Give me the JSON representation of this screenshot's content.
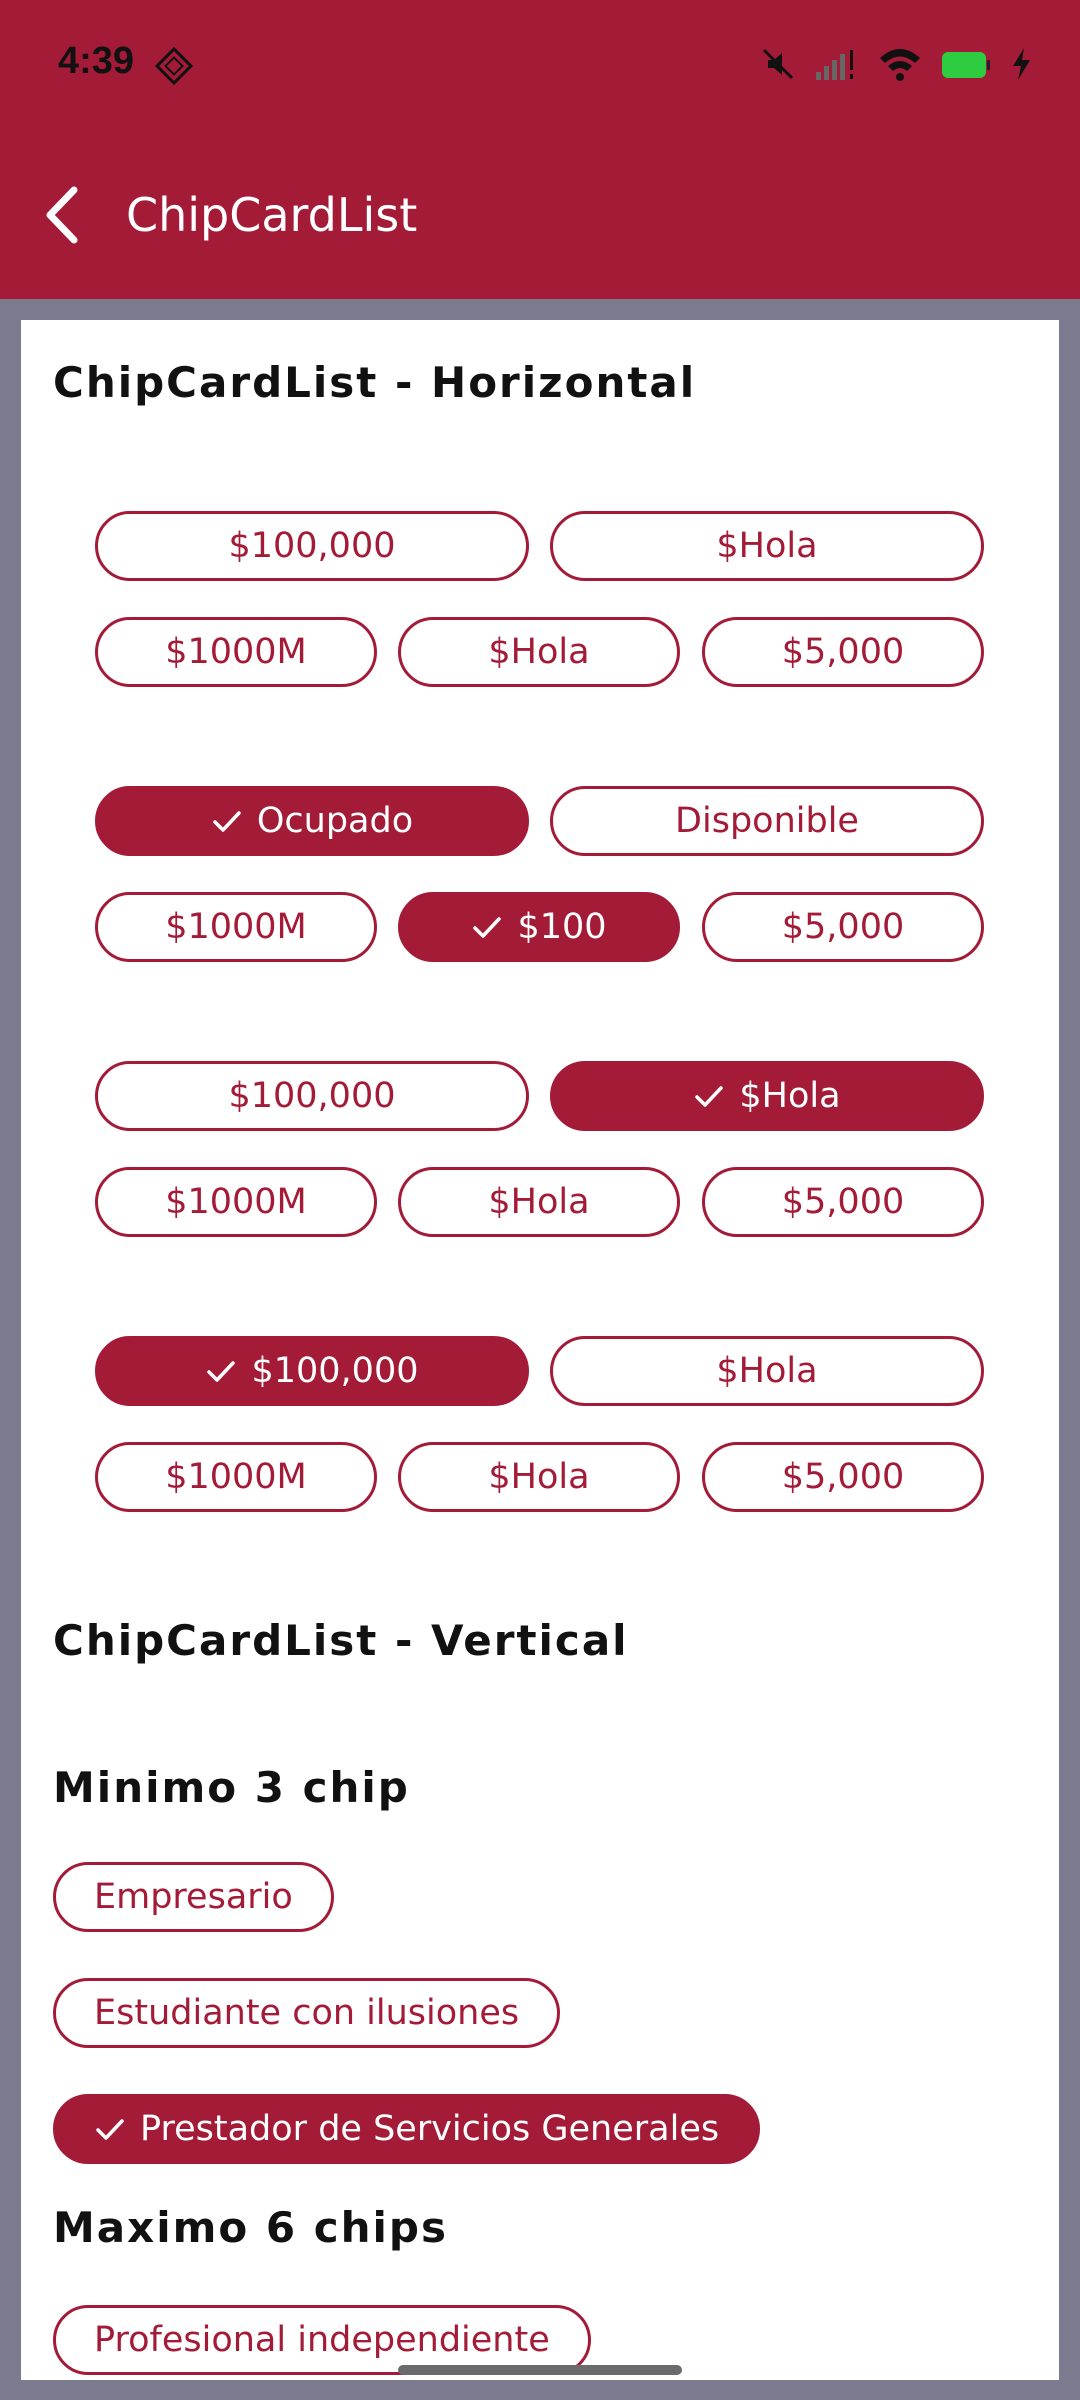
{
  "status": {
    "time": "4:39"
  },
  "appbar": {
    "title": "ChipCardList"
  },
  "horizontal": {
    "title": "ChipCardList - Horizontal",
    "groups": [
      {
        "row1": [
          {
            "label": "$100,000",
            "selected": false
          },
          {
            "label": "$Hola",
            "selected": false
          }
        ],
        "row2": [
          {
            "label": "$1000M",
            "selected": false
          },
          {
            "label": "$Hola",
            "selected": false
          },
          {
            "label": "$5,000",
            "selected": false
          }
        ]
      },
      {
        "row1": [
          {
            "label": "Ocupado",
            "selected": true
          },
          {
            "label": "Disponible",
            "selected": false
          }
        ],
        "row2": [
          {
            "label": "$1000M",
            "selected": false
          },
          {
            "label": "$100",
            "selected": true
          },
          {
            "label": "$5,000",
            "selected": false
          }
        ]
      },
      {
        "row1": [
          {
            "label": "$100,000",
            "selected": false
          },
          {
            "label": "$Hola",
            "selected": true
          }
        ],
        "row2": [
          {
            "label": "$1000M",
            "selected": false
          },
          {
            "label": "$Hola",
            "selected": false
          },
          {
            "label": "$5,000",
            "selected": false
          }
        ]
      },
      {
        "row1": [
          {
            "label": "$100,000",
            "selected": true
          },
          {
            "label": "$Hola",
            "selected": false
          }
        ],
        "row2": [
          {
            "label": "$1000M",
            "selected": false
          },
          {
            "label": "$Hola",
            "selected": false
          },
          {
            "label": "$5,000",
            "selected": false
          }
        ]
      }
    ]
  },
  "vertical": {
    "title": "ChipCardList - Vertical",
    "min_title": "Minimo 3 chip",
    "min_chips": [
      {
        "label": "Empresario",
        "selected": false
      },
      {
        "label": "Estudiante con ilusiones",
        "selected": false
      },
      {
        "label": "Prestador de Servicios Generales",
        "selected": true
      }
    ],
    "max_title": "Maximo 6 chips",
    "max_chips": [
      {
        "label": "Profesional independiente",
        "selected": false
      }
    ]
  },
  "colors": {
    "primary": "#a31b37",
    "background": "#7b7a8e",
    "surface": "#ffffff"
  }
}
